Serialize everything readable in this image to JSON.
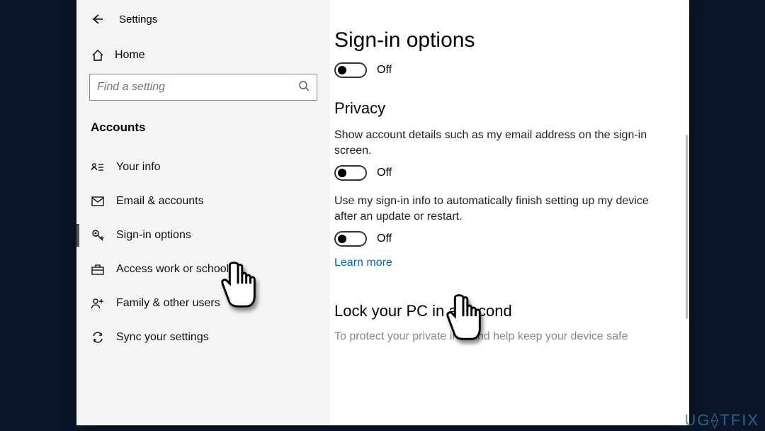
{
  "window": {
    "title": "Settings"
  },
  "sidebar": {
    "home": "Home",
    "search_placeholder": "Find a setting",
    "section": "Accounts",
    "items": [
      {
        "icon": "person-card-icon",
        "label": "Your info"
      },
      {
        "icon": "mail-icon",
        "label": "Email & accounts"
      },
      {
        "icon": "key-icon",
        "label": "Sign-in options",
        "active": true
      },
      {
        "icon": "briefcase-icon",
        "label": "Access work or school"
      },
      {
        "icon": "people-icon",
        "label": "Family & other users"
      },
      {
        "icon": "sync-icon",
        "label": "Sync your settings"
      }
    ]
  },
  "main": {
    "heading": "Sign-in options",
    "toggle1_state": "Off",
    "privacy_heading": "Privacy",
    "privacy_desc1": "Show account details such as my email address on the sign-in screen.",
    "toggle2_state": "Off",
    "privacy_desc2": "Use my sign-in info to automatically finish setting up my device after an update or restart.",
    "toggle3_state": "Off",
    "learn_more": "Learn more",
    "lock_heading": "Lock your PC in a second",
    "lock_desc": "To protect your private info and help keep your device safe"
  },
  "watermark": "UG⟠TFIX"
}
